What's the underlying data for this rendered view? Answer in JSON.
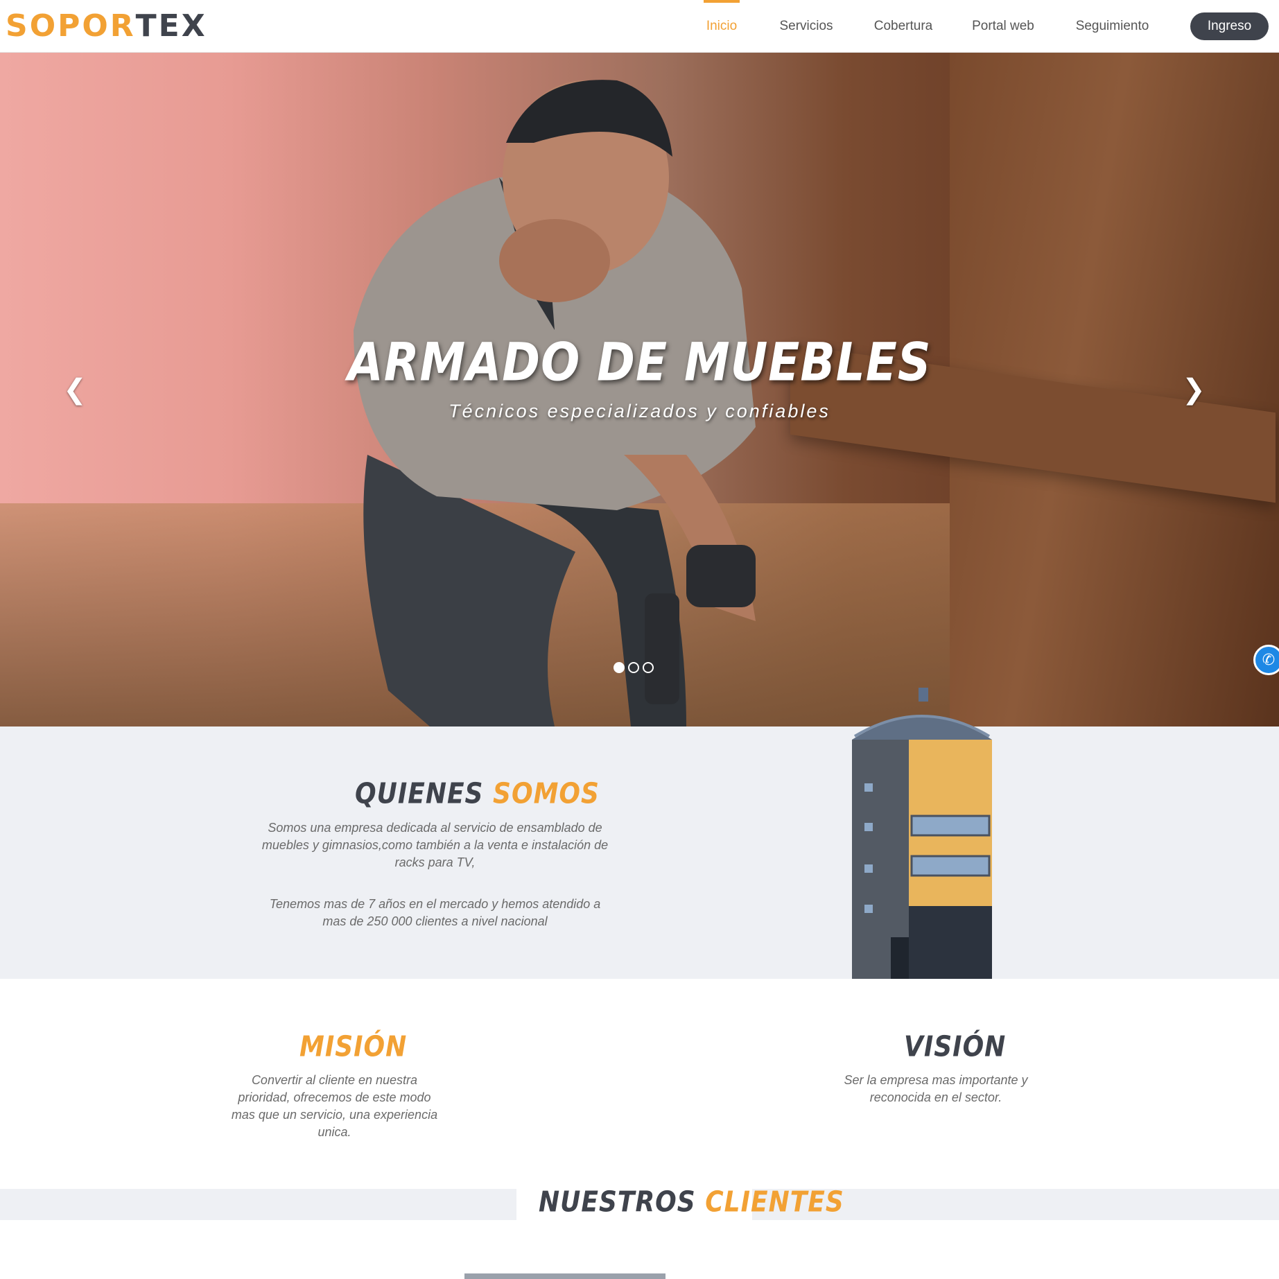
{
  "header": {
    "logo": {
      "part1": "SOPOR",
      "part2": "TEX"
    },
    "nav": [
      {
        "label": "Inicio",
        "active": true
      },
      {
        "label": "Servicios",
        "active": false
      },
      {
        "label": "Cobertura",
        "active": false
      },
      {
        "label": "Portal web",
        "active": false
      },
      {
        "label": "Seguimiento",
        "active": false
      }
    ],
    "login_label": "Ingreso",
    "accent_color": "#f2a134",
    "dark_color": "#3f434c"
  },
  "hero": {
    "title": "ARMADO DE MUEBLES",
    "subtitle": "Técnicos especializados y confiables",
    "prev_icon": "chevron-left-icon",
    "next_icon": "chevron-right-icon",
    "slides_total": 3,
    "active_slide": 1
  },
  "about": {
    "title_part1": "QUIENES",
    "title_part2": "SOMOS",
    "paragraph1": "Somos una empresa dedicada al servicio de ensamblado de muebles y gimnasios,como también a la venta e instalación de racks para TV,",
    "paragraph2": "Tenemos mas de 7 años en el mercado y hemos atendido a mas de 250 000 clientes a nivel nacional"
  },
  "mission": {
    "title": "MISIÓN",
    "text": "Convertir al cliente en nuestra prioridad, ofrecemos de este modo mas que un servicio, una experiencia unica."
  },
  "vision": {
    "title": "VISIÓN",
    "text": "Ser la empresa mas importante y reconocida en el sector."
  },
  "clients": {
    "title_part1": "NUESTROS",
    "title_part2": "CLIENTES"
  }
}
